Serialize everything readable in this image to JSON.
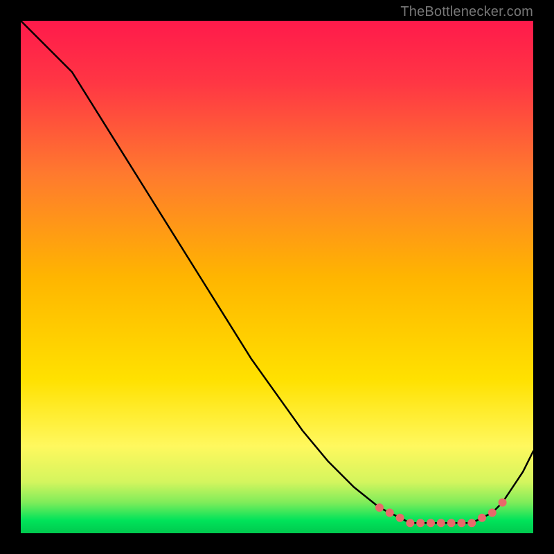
{
  "watermark": "TheBottlenecker.com",
  "colors": {
    "top": "#ff1a4b",
    "mid": "#ffd000",
    "greenBand": "#00e35a",
    "curve": "#000000",
    "dot": "#e86a6a",
    "background": "#000000"
  },
  "chart_data": {
    "type": "line",
    "title": "",
    "xlabel": "",
    "ylabel": "",
    "xlim": [
      0,
      100
    ],
    "ylim": [
      0,
      100
    ],
    "grid": false,
    "legend": false,
    "series": [
      {
        "name": "bottleneck-curve",
        "x": [
          0,
          5,
          10,
          15,
          20,
          25,
          30,
          35,
          40,
          45,
          50,
          55,
          60,
          65,
          70,
          72,
          74,
          76,
          78,
          80,
          82,
          84,
          86,
          88,
          90,
          92,
          94,
          96,
          98,
          100
        ],
        "y": [
          100,
          95,
          90,
          82,
          74,
          66,
          58,
          50,
          42,
          34,
          27,
          20,
          14,
          9,
          5,
          4,
          3,
          2,
          2,
          2,
          2,
          2,
          2,
          2,
          3,
          4,
          6,
          9,
          12,
          16
        ]
      }
    ],
    "markers": {
      "name": "optimal-range-dots",
      "x": [
        70,
        72,
        74,
        76,
        78,
        80,
        82,
        84,
        86,
        88,
        90,
        92,
        94
      ],
      "y": [
        5,
        4,
        3,
        2,
        2,
        2,
        2,
        2,
        2,
        2,
        3,
        4,
        6
      ]
    },
    "background_gradient": {
      "type": "vertical",
      "stops": [
        {
          "pos": 0.0,
          "color": "#ff1a4b"
        },
        {
          "pos": 0.12,
          "color": "#ff3644"
        },
        {
          "pos": 0.3,
          "color": "#ff7a2e"
        },
        {
          "pos": 0.5,
          "color": "#ffb500"
        },
        {
          "pos": 0.7,
          "color": "#ffe100"
        },
        {
          "pos": 0.83,
          "color": "#fff85e"
        },
        {
          "pos": 0.9,
          "color": "#d4f55e"
        },
        {
          "pos": 0.94,
          "color": "#7fec5a"
        },
        {
          "pos": 0.975,
          "color": "#00e35a"
        },
        {
          "pos": 1.0,
          "color": "#00c94e"
        }
      ]
    }
  }
}
